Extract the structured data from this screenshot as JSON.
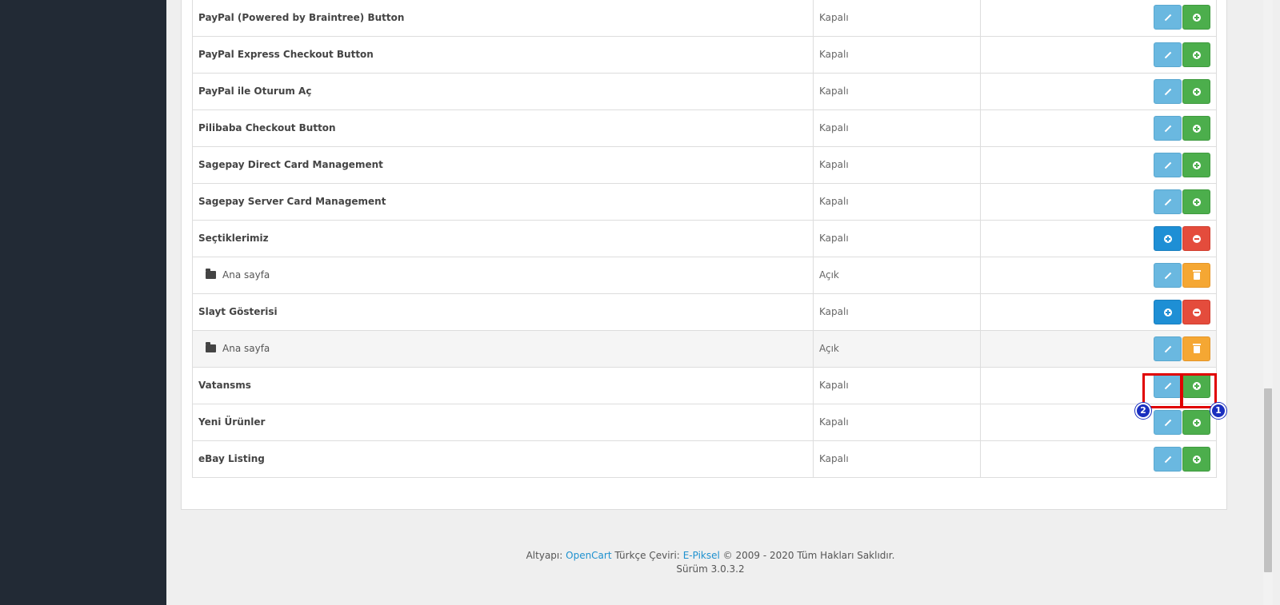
{
  "extensions": [
    {
      "name": "PayPal (Powered by Braintree) Button",
      "status": "Kapalı",
      "type": "module",
      "actions": [
        "edit",
        "install"
      ]
    },
    {
      "name": "PayPal Express Checkout Button",
      "status": "Kapalı",
      "type": "module",
      "actions": [
        "edit",
        "install"
      ]
    },
    {
      "name": "PayPal ile Oturum Aç",
      "status": "Kapalı",
      "type": "module",
      "actions": [
        "edit",
        "install"
      ]
    },
    {
      "name": "Pilibaba Checkout Button",
      "status": "Kapalı",
      "type": "module",
      "actions": [
        "edit",
        "install"
      ]
    },
    {
      "name": "Sagepay Direct Card Management",
      "status": "Kapalı",
      "type": "module",
      "actions": [
        "edit",
        "install"
      ]
    },
    {
      "name": "Sagepay Server Card Management",
      "status": "Kapalı",
      "type": "module",
      "actions": [
        "edit",
        "install"
      ]
    },
    {
      "name": "Seçtiklerimiz",
      "status": "Kapalı",
      "type": "module",
      "actions": [
        "add",
        "uninstall"
      ]
    },
    {
      "name": "Ana sayfa",
      "status": "Açık",
      "type": "submodule",
      "actions": [
        "edit",
        "delete"
      ]
    },
    {
      "name": "Slayt Gösterisi",
      "status": "Kapalı",
      "type": "module",
      "actions": [
        "add",
        "uninstall"
      ]
    },
    {
      "name": "Ana sayfa",
      "status": "Açık",
      "type": "submodule",
      "actions": [
        "edit",
        "delete"
      ]
    },
    {
      "name": "Vatansms",
      "status": "Kapalı",
      "type": "module",
      "actions": [
        "edit",
        "install"
      ]
    },
    {
      "name": "Yeni Ürünler",
      "status": "Kapalı",
      "type": "module",
      "actions": [
        "edit",
        "install"
      ]
    },
    {
      "name": "eBay Listing",
      "status": "Kapalı",
      "type": "module",
      "actions": [
        "edit",
        "install"
      ]
    }
  ],
  "annotations": {
    "badge_1": "1",
    "badge_2": "2"
  },
  "footer": {
    "prefix": "Altyapı:",
    "opencart_link": "OpenCart",
    "translation_label": "Türkçe Çeviri:",
    "epiksel_link": "E-Piksel",
    "copyright": "© 2009 - 2020 Tüm Hakları Saklıdır.",
    "version": "Sürüm 3.0.3.2"
  },
  "colors": {
    "sidebar": "#222a35",
    "edit_button": "#6ab8e0",
    "install_button": "#4cae4c",
    "add_button": "#1e8fd5",
    "uninstall_button": "#e44c3c",
    "delete_button": "#f5a733",
    "highlight": "#e00000",
    "badge": "#1a2fbf",
    "link": "#1e91cf"
  }
}
